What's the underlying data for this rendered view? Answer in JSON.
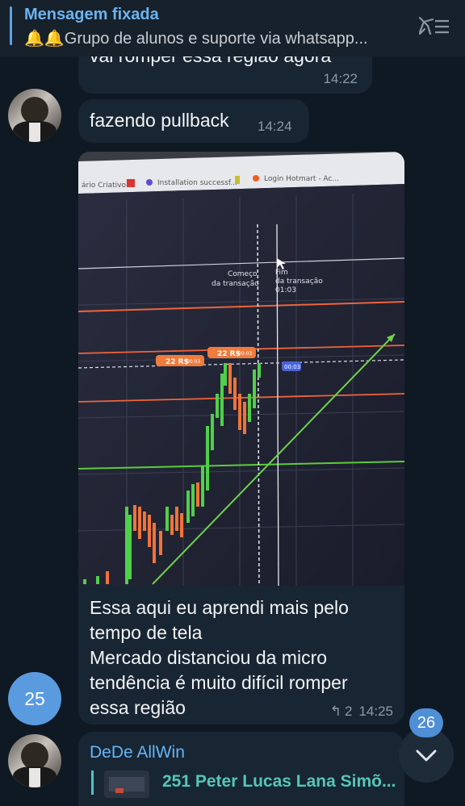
{
  "pinned": {
    "title": "Mensagem fixada",
    "text": "🔔🔔Grupo de alunos e suporte via whatsapp..."
  },
  "messages": [
    {
      "text": "vai romper essa região agora",
      "time": "14:22"
    },
    {
      "text": "fazendo pullback",
      "time": "14:24"
    }
  ],
  "photo": {
    "browser_tabs": [
      "ário Criativo",
      "Installation successf...",
      "Login Hotmart - Ac..."
    ],
    "annotations": {
      "start": [
        "Começo",
        "da transação"
      ],
      "end": [
        "Fim",
        "da transação",
        "01:03"
      ],
      "tags": [
        "22 R$",
        "22 R$"
      ],
      "tag_small": [
        "00:03",
        "00:03"
      ],
      "price_tag": "00:03"
    }
  },
  "caption": {
    "lines": [
      "Essa aqui eu aprendi mais pelo",
      "tempo de tela",
      "Mercado distanciou da micro",
      "tendência é muito difícil romper",
      "essa região"
    ],
    "reply_count": "2",
    "time": "14:25"
  },
  "unread_badge": "25",
  "scroll_counter": "26",
  "next": {
    "sender": "DeDe AllWin",
    "reply_text": "251 Peter Lucas Lana Simõ..."
  }
}
